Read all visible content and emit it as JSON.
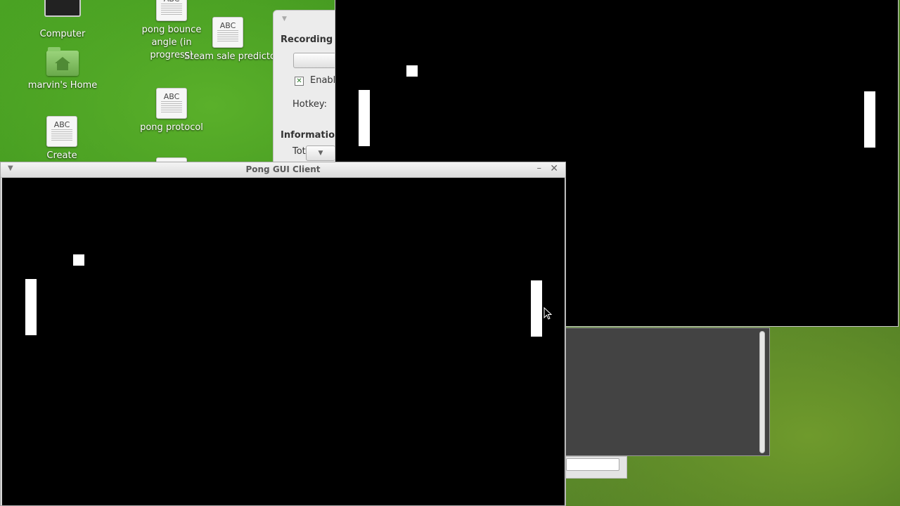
{
  "desktop": {
    "icons": [
      {
        "label": "Computer"
      },
      {
        "label": "pong bounce angle (in progress)",
        "doc_text": "ABC"
      },
      {
        "label": "Steam sale predictor",
        "doc_text": "ABC"
      },
      {
        "label": "marvin's Home"
      },
      {
        "label": "pong protocol",
        "doc_text": "ABC"
      },
      {
        "label": "Create",
        "doc_text": "ABC"
      }
    ]
  },
  "recording_panel": {
    "recording_header": "Recording",
    "enable_label": "Enabl",
    "enable_checked": true,
    "hotkey_label": "Hotkey:",
    "information_header": "Information",
    "total_label": "Tot"
  },
  "main_window": {
    "title": "Pong GUI Client"
  },
  "colors": {
    "canvas": "#000000",
    "paddle": "#ffffff",
    "ball": "#ffffff"
  }
}
